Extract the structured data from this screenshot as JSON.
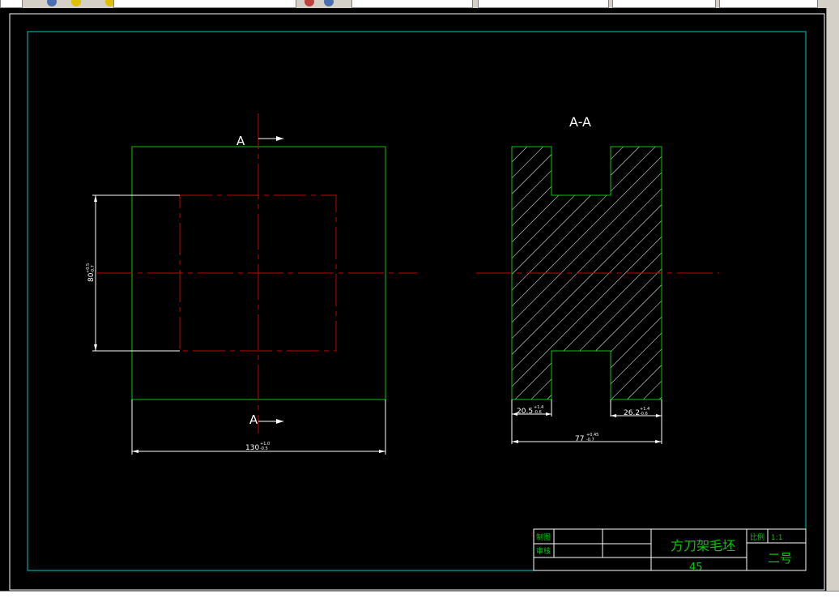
{
  "colors": {
    "background": "#000000",
    "border": "#00c8c8",
    "outline": "#00c800",
    "centerline": "#c80000",
    "dimension": "#ffffff",
    "title_text": "#00c800"
  },
  "drawing": {
    "section_mark_top": "A",
    "section_mark_bottom": "A",
    "section_title": "A-A",
    "dimensions": {
      "left_height": {
        "base": "80",
        "upper": "+0.5",
        "lower": "-0.7"
      },
      "left_width": {
        "base": "130",
        "upper": "+1.0",
        "lower": "-0.5"
      },
      "section_left_flange": {
        "base": "20.5",
        "upper": "+1.4",
        "lower": "-0.6"
      },
      "section_right_flange": {
        "base": "26.2",
        "upper": "+1.4",
        "lower": "-0.6"
      },
      "section_total_width": {
        "base": "77",
        "upper": "+0.45",
        "lower": "-0.7"
      }
    }
  },
  "title_block": {
    "drawn_by_label": "制图",
    "checked_by_label": "审核",
    "part_name": "方刀架毛坯",
    "material": "45",
    "scale_label": "比例",
    "scale_value": "1:1",
    "sheet_size": "二号"
  }
}
